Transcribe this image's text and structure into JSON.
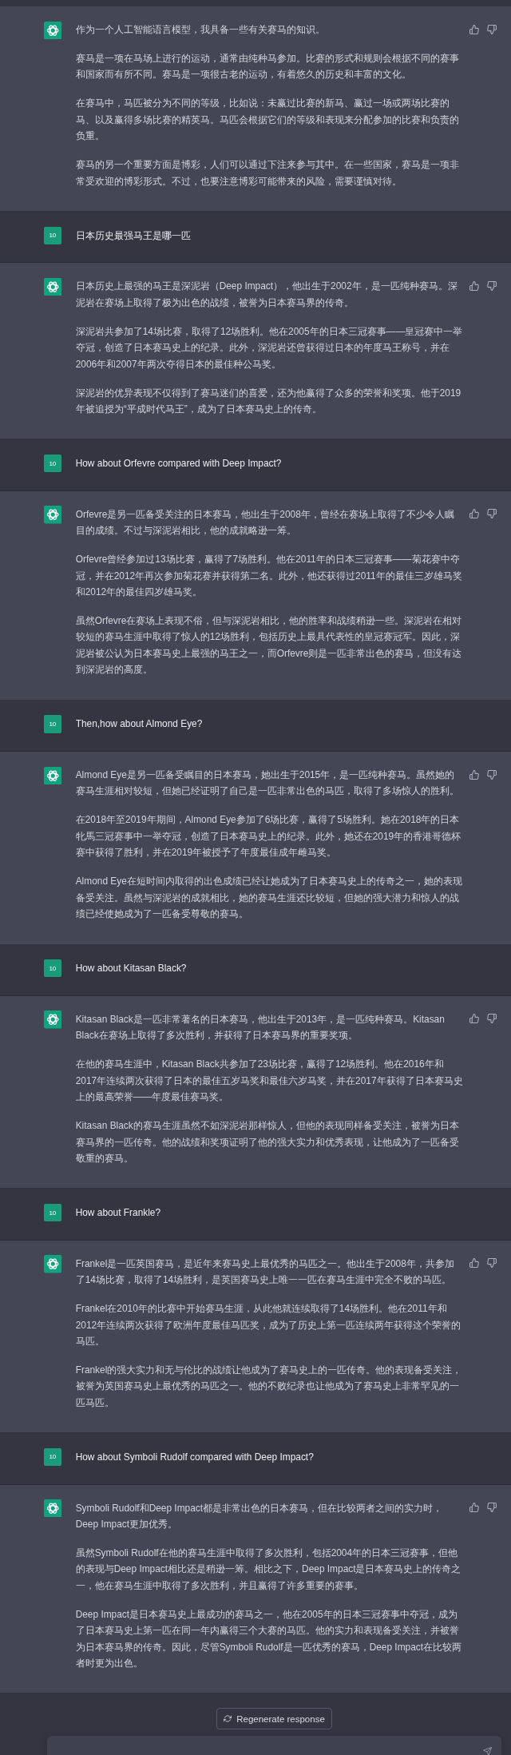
{
  "conversation": [
    {
      "kind": "assistant",
      "paragraphs": [
        "作为一个人工智能语言模型，我具备一些有关赛马的知识。",
        "赛马是一项在马场上进行的运动，通常由纯种马参加。比赛的形式和规则会根据不同的赛事和国家而有所不同。赛马是一项很古老的运动，有着悠久的历史和丰富的文化。",
        "在赛马中，马匹被分为不同的等级，比如说：未赢过比赛的新马、赢过一场或两场比赛的马、以及赢得多场比赛的精英马。马匹会根据它们的等级和表现来分配参加的比赛和负责的负重。",
        "赛马的另一个重要方面是博彩，人们可以通过下注来参与其中。在一些国家，赛马是一项非常受欢迎的博彩形式。不过，也要注意博彩可能带来的风险，需要谨慎对待。"
      ]
    },
    {
      "kind": "user",
      "avatar": "10",
      "text": "日本历史最强马王是哪一匹"
    },
    {
      "kind": "assistant",
      "paragraphs": [
        "日本历史上最强的马王是深泥岩（Deep Impact），他出生于2002年，是一匹纯种赛马。深泥岩在赛场上取得了极为出色的战绩，被誉为日本赛马界的传奇。",
        "深泥岩共参加了14场比赛，取得了12场胜利。他在2005年的日本三冠赛事——皇冠赛中一举夺冠，创造了日本赛马史上的纪录。此外，深泥岩还曾获得过日本的年度马王称号，并在2006年和2007年两次夺得日本的最佳种公马奖。",
        "深泥岩的优异表现不仅得到了赛马迷们的喜爱，还为他赢得了众多的荣誉和奖项。他于2019年被追授为“平成时代马王”，成为了日本赛马史上的传奇。"
      ]
    },
    {
      "kind": "user",
      "avatar": "10",
      "text": "How about Orfevre compared with Deep Impact?"
    },
    {
      "kind": "assistant",
      "paragraphs": [
        "Orfevre是另一匹备受关注的日本赛马，他出生于2008年，曾经在赛场上取得了不少令人瞩目的成绩。不过与深泥岩相比，他的成就略逊一筹。",
        "Orfevre曾经参加过13场比赛，赢得了7场胜利。他在2011年的日本三冠赛事——菊花赛中夺冠，并在2012年再次参加菊花赛并获得第二名。此外，他还获得过2011年的最佳三岁雄马奖和2012年的最佳四岁雄马奖。",
        "虽然Orfevre在赛场上表现不俗，但与深泥岩相比，他的胜率和战绩稍逊一些。深泥岩在相对较短的赛马生涯中取得了惊人的12场胜利，包括历史上最具代表性的皇冠赛冠军。因此，深泥岩被公认为日本赛马史上最强的马王之一，而Orfevre则是一匹非常出色的赛马，但没有达到深泥岩的高度。"
      ]
    },
    {
      "kind": "user",
      "avatar": "10",
      "text": "Then,how about Almond Eye?"
    },
    {
      "kind": "assistant",
      "paragraphs": [
        "Almond Eye是另一匹备受瞩目的日本赛马，她出生于2015年，是一匹纯种赛马。虽然她的赛马生涯相对较短，但她已经证明了自己是一匹非常出色的马匹，取得了多场惊人的胜利。",
        "在2018年至2019年期间，Almond Eye参加了6场比赛，赢得了5场胜利。她在2018年的日本牝馬三冠赛事中一举夺冠，创造了日本赛马史上的纪录。此外，她还在2019年的香港哥德杯赛中获得了胜利，并在2019年被授予了年度最佳成年雌马奖。",
        "Almond Eye在短时间内取得的出色成绩已经让她成为了日本赛马史上的传奇之一，她的表现备受关注。虽然与深泥岩的成就相比，她的赛马生涯还比较短，但她的强大潜力和惊人的战绩已经使她成为了一匹备受尊敬的赛马。"
      ]
    },
    {
      "kind": "user",
      "avatar": "10",
      "text": "How about Kitasan Black?"
    },
    {
      "kind": "assistant",
      "paragraphs": [
        "Kitasan Black是一匹非常著名的日本赛马，他出生于2013年，是一匹纯种赛马。Kitasan Black在赛场上取得了多次胜利，并获得了日本赛马界的重要奖项。",
        "在他的赛马生涯中，Kitasan Black共参加了23场比赛，赢得了12场胜利。他在2016年和2017年连续两次获得了日本的最佳五岁马奖和最佳六岁马奖，并在2017年获得了日本赛马史上的最高荣誉——年度最佳赛马奖。",
        "Kitasan Black的赛马生涯虽然不如深泥岩那样惊人，但他的表现同样备受关注，被誉为日本赛马界的一匹传奇。他的战绩和奖项证明了他的强大实力和优秀表现，让他成为了一匹备受敬重的赛马。"
      ]
    },
    {
      "kind": "user",
      "avatar": "10",
      "text": "How about Frankle?"
    },
    {
      "kind": "assistant",
      "paragraphs": [
        "Frankel是一匹英国赛马，是近年来赛马史上最优秀的马匹之一。他出生于2008年，共参加了14场比赛，取得了14场胜利，是英国赛马史上唯一一匹在赛马生涯中完全不败的马匹。",
        "Frankel在2010年的比赛中开始赛马生涯，从此他就连续取得了14场胜利。他在2011年和2012年连续两次获得了欧洲年度最佳马匹奖，成为了历史上第一匹连续两年获得这个荣誉的马匹。",
        "Frankel的强大实力和无与伦比的战绩让他成为了赛马史上的一匹传奇。他的表现备受关注，被誉为英国赛马史上最优秀的马匹之一。他的不败纪录也让他成为了赛马史上非常罕见的一匹马匹。"
      ]
    },
    {
      "kind": "user",
      "avatar": "10",
      "text": "How about Symboli Rudolf compared with Deep Impact?"
    },
    {
      "kind": "assistant",
      "paragraphs": [
        "Symboli Rudolf和Deep Impact都是非常出色的日本赛马，但在比较两者之间的实力时，Deep Impact更加优秀。",
        "虽然Symboli Rudolf在他的赛马生涯中取得了多次胜利，包括2004年的日本三冠赛事，但他的表现与Deep Impact相比还是稍逊一筹。相比之下，Deep Impact是日本赛马史上的传奇之一，他在赛马生涯中取得了多次胜利，并且赢得了许多重要的赛事。",
        "Deep Impact是日本赛马史上最成功的赛马之一，他在2005年的日本三冠赛事中夺冠，成为了日本赛马史上第一匹在同一年内赢得三个大赛的马匹。他的实力和表现备受关注，并被誉为日本赛马界的传奇。因此，尽管Symboli Rudolf是一匹优秀的赛马，Deep Impact在比较两者时更为出色。"
      ]
    }
  ],
  "footer": {
    "regenerate_label": "Regenerate response"
  }
}
